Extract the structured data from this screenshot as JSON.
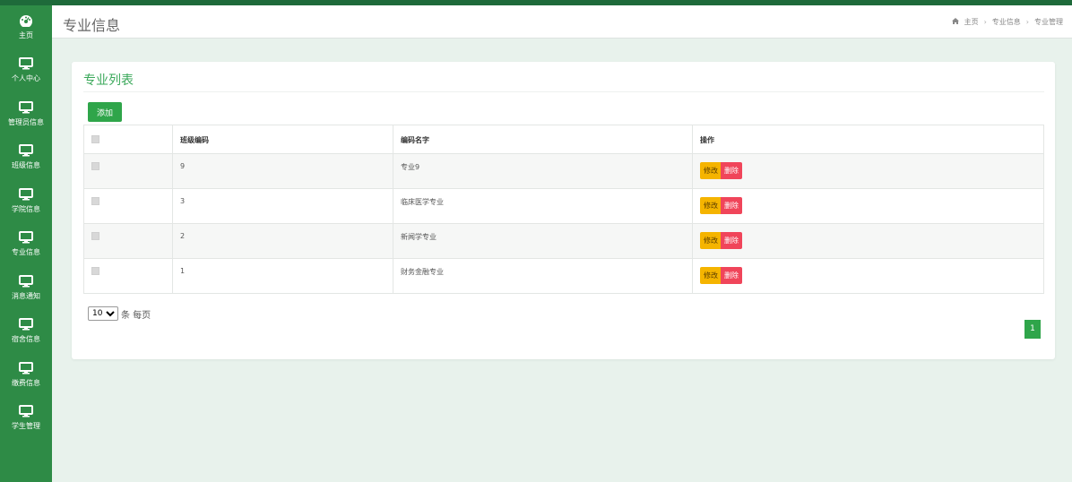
{
  "sidebar": {
    "items": [
      {
        "label": "主页",
        "icon": "dashboard-icon"
      },
      {
        "label": "个人中心",
        "icon": "monitor-icon"
      },
      {
        "label": "管理员信息",
        "icon": "monitor-icon"
      },
      {
        "label": "班级信息",
        "icon": "monitor-icon"
      },
      {
        "label": "学院信息",
        "icon": "monitor-icon"
      },
      {
        "label": "专业信息",
        "icon": "monitor-icon"
      },
      {
        "label": "消息通知",
        "icon": "monitor-icon"
      },
      {
        "label": "宿舍信息",
        "icon": "monitor-icon"
      },
      {
        "label": "缴费信息",
        "icon": "monitor-icon"
      },
      {
        "label": "学生管理",
        "icon": "monitor-icon"
      }
    ]
  },
  "header": {
    "title": "专业信息",
    "breadcrumb": [
      "主页",
      "专业信息",
      "专业管理"
    ],
    "home_icon": "home-icon"
  },
  "card": {
    "title": "专业列表",
    "add_label": "添加"
  },
  "table": {
    "headers": [
      "班级编码",
      "编码名字",
      "操作"
    ],
    "rows": [
      {
        "code": "9",
        "name": "专业9"
      },
      {
        "code": "3",
        "name": "临床医学专业"
      },
      {
        "code": "2",
        "name": "新闻学专业"
      },
      {
        "code": "1",
        "name": "财务金融专业"
      }
    ],
    "edit_label": "修改",
    "delete_label": "删除"
  },
  "pager": {
    "page_size": "10",
    "page_size_suffix": "条 每页",
    "current_page": "1"
  },
  "colors": {
    "sidebar": "#2e8b46",
    "accent": "#2fa54a",
    "edit": "#f5b400",
    "delete": "#f0455a"
  }
}
